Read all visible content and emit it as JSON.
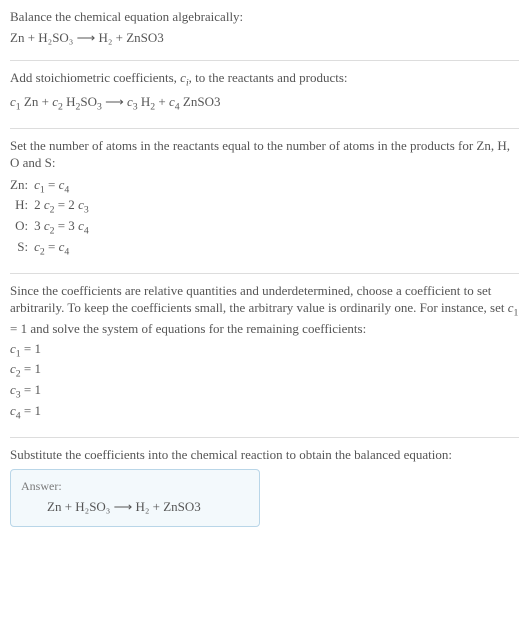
{
  "s1": {
    "intro": "Balance the chemical equation algebraically:",
    "eq": "Zn + H₂SO₃ ⟶ H₂ + ZnSO3"
  },
  "s2": {
    "intro_a": "Add stoichiometric coefficients, ",
    "ci": "c",
    "ci_sub": "i",
    "intro_b": ", to the reactants and products:",
    "eq": {
      "c1": "c",
      "c1s": "1",
      "t1": " Zn + ",
      "c2": "c",
      "c2s": "2",
      "t2": " H",
      "t2h": "2",
      "t2so": "SO",
      "t2so_s": "3",
      "t3": " ⟶ ",
      "c3": "c",
      "c3s": "3",
      "t4": " H",
      "t4h": "2",
      "t5": " + ",
      "c4": "c",
      "c4s": "4",
      "t6": " ZnSO3"
    }
  },
  "s3": {
    "intro": "Set the number of atoms in the reactants equal to the number of atoms in the products for Zn, H, O and S:",
    "rows": [
      {
        "label": "Zn:",
        "lhs_a": "c",
        "lhs_as": "1",
        "mid": " = ",
        "rhs_a": "c",
        "rhs_as": "4",
        "pre": "",
        "pre_r": ""
      },
      {
        "label": "H:",
        "pre": "2 ",
        "lhs_a": "c",
        "lhs_as": "2",
        "mid": " = 2 ",
        "rhs_a": "c",
        "rhs_as": "3",
        "pre_r": ""
      },
      {
        "label": "O:",
        "pre": "3 ",
        "lhs_a": "c",
        "lhs_as": "2",
        "mid": " = 3 ",
        "rhs_a": "c",
        "rhs_as": "4",
        "pre_r": ""
      },
      {
        "label": "S:",
        "pre": "",
        "lhs_a": "c",
        "lhs_as": "2",
        "mid": " = ",
        "rhs_a": "c",
        "rhs_as": "4",
        "pre_r": ""
      }
    ]
  },
  "s4": {
    "intro_a": "Since the coefficients are relative quantities and underdetermined, choose a coefficient to set arbitrarily. To keep the coefficients small, the arbitrary value is ordinarily one. For instance, set ",
    "c1": "c",
    "c1s": "1",
    "intro_b": " = 1 and solve the system of equations for the remaining coefficients:",
    "lines": [
      {
        "c": "c",
        "cs": "1",
        "v": " = 1"
      },
      {
        "c": "c",
        "cs": "2",
        "v": " = 1"
      },
      {
        "c": "c",
        "cs": "3",
        "v": " = 1"
      },
      {
        "c": "c",
        "cs": "4",
        "v": " = 1"
      }
    ]
  },
  "s5": {
    "intro": "Substitute the coefficients into the chemical reaction to obtain the balanced equation:",
    "answer_label": "Answer:",
    "answer_eq": "Zn + H₂SO₃ ⟶ H₂ + ZnSO3"
  },
  "chart_data": {
    "type": "table",
    "title": "Atom balance equations",
    "rows": [
      {
        "element": "Zn",
        "equation": "c1 = c4"
      },
      {
        "element": "H",
        "equation": "2 c2 = 2 c3"
      },
      {
        "element": "O",
        "equation": "3 c2 = 3 c4"
      },
      {
        "element": "S",
        "equation": "c2 = c4"
      }
    ],
    "solution": {
      "c1": 1,
      "c2": 1,
      "c3": 1,
      "c4": 1
    },
    "balanced_equation": "Zn + H2SO3 ⟶ H2 + ZnSO3"
  }
}
